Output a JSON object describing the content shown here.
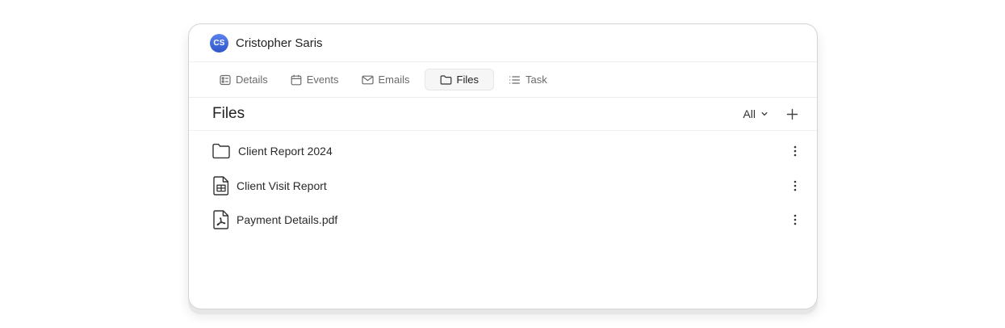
{
  "contact": {
    "initials": "CS",
    "name": "Cristopher Saris",
    "avatar_color": "#3d63d6"
  },
  "tabs": [
    {
      "label": "Details",
      "icon": "details-icon",
      "active": false
    },
    {
      "label": "Events",
      "icon": "calendar-icon",
      "active": false
    },
    {
      "label": "Emails",
      "icon": "mail-icon",
      "active": false
    },
    {
      "label": "Files",
      "icon": "folder-icon",
      "active": true
    },
    {
      "label": "Task",
      "icon": "list-icon",
      "active": false
    }
  ],
  "files_panel": {
    "title": "Files",
    "filter_label": "All",
    "add_icon": "plus-icon"
  },
  "files": [
    {
      "name": "Client Report 2024",
      "type": "folder",
      "icon": "folder-icon"
    },
    {
      "name": "Client Visit Report",
      "type": "spreadsheet",
      "icon": "spreadsheet-file-icon"
    },
    {
      "name": "Payment Details.pdf",
      "type": "pdf",
      "icon": "pdf-file-icon"
    }
  ]
}
